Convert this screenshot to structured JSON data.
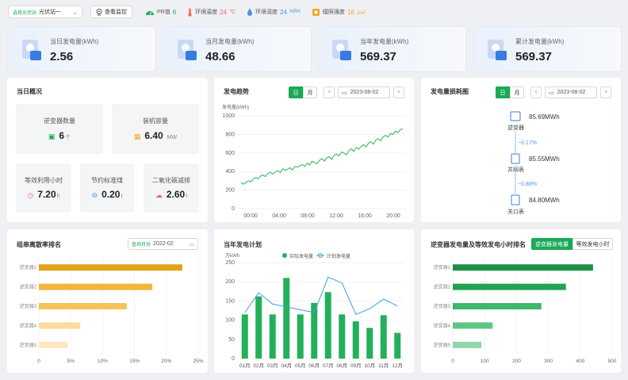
{
  "topbar": {
    "site_prefix": "选择光伏站",
    "site_value": "光伏站一",
    "monitor_label": "查看监控",
    "pr_label": "PR值",
    "pr_value": "6",
    "temp_label": "环境温度",
    "temp_value": "24",
    "temp_unit": "℃",
    "hum_label": "环境湿度",
    "hum_value": "24",
    "hum_unit": "%RH",
    "rad_label": "辐照强度",
    "rad_value": "16",
    "rad_unit": "J/㎡"
  },
  "stats": [
    {
      "label": "当日发电量(kWh)",
      "value": "2.56"
    },
    {
      "label": "当月发电量(kWh)",
      "value": "48.66"
    },
    {
      "label": "当年发电量(kWh)",
      "value": "569.37"
    },
    {
      "label": "累计发电量(kWh)",
      "value": "569.37"
    }
  ],
  "overview": {
    "title": "当日概况",
    "inverter_label": "逆变器数量",
    "inverter_value": "6",
    "inverter_unit": "个",
    "capacity_label": "装机容量",
    "capacity_value": "6.40",
    "capacity_unit": "MW",
    "hours_label": "等效利用小时",
    "hours_value": "7.20",
    "hours_unit": "h",
    "coal_label": "节约标准煤",
    "coal_value": "0.20",
    "coal_unit": "t",
    "co2_label": "二氧化碳减排",
    "co2_value": "2.60",
    "co2_unit": "t"
  },
  "trend": {
    "title": "发电趋势",
    "tab_day": "日",
    "tab_month": "月",
    "date": "2023-08-02",
    "prev": "<",
    "next": ">",
    "unit": "发电量(kWh)"
  },
  "loss": {
    "title": "发电量损耗图",
    "tab_day": "日",
    "tab_month": "月",
    "date": "2023-08-02",
    "prev": "<",
    "next": ">",
    "nodes": [
      {
        "name": "逆变器",
        "value": "85.69MWh"
      },
      {
        "name": "并网表",
        "value": "85.55MWh"
      },
      {
        "name": "关口表",
        "value": "84.80MWh"
      }
    ],
    "pct1": "−0.17%",
    "pct2": "−0.88%"
  },
  "dispersion": {
    "title": "组串离散率排名",
    "query_label": "查询月份",
    "query_value": "2022-02"
  },
  "plan": {
    "title": "当年发电计划",
    "unit": "万kWh",
    "legend_actual": "实际发电量",
    "legend_plan": "计划发电量"
  },
  "ranking": {
    "title": "逆变器发电量及等效发电小时排名",
    "tab1": "逆变器发电量",
    "tab2": "等效发电小时"
  },
  "chart_data": [
    {
      "type": "line",
      "title": "发电趋势",
      "ylabel": "发电量(kWh)",
      "ylim": [
        0,
        1000
      ],
      "yticks": [
        0,
        200,
        400,
        600,
        800,
        1000
      ],
      "xticks": [
        "00:00",
        "04:00",
        "08:00",
        "12:00",
        "16:00",
        "20:00"
      ],
      "series": [
        {
          "values": [
            280,
            262,
            285,
            300,
            291,
            320,
            335,
            322,
            352,
            362,
            345,
            380,
            392,
            372,
            395,
            410,
            388,
            430,
            412,
            425,
            440,
            418,
            455,
            448,
            462,
            475,
            455,
            490,
            470,
            510,
            495,
            485,
            520,
            540,
            512,
            548,
            560,
            530,
            575,
            590,
            570,
            610,
            600,
            580,
            625,
            645,
            615,
            660,
            640,
            670,
            690,
            665,
            705,
            720,
            695,
            740,
            752,
            730,
            775,
            790,
            770,
            810,
            800,
            835,
            820,
            850,
            860
          ]
        }
      ]
    },
    {
      "type": "bar",
      "title": "组串离散率排名",
      "orientation": "horizontal",
      "categories": [
        "逆变器1",
        "逆变器2",
        "逆变器3",
        "逆变器4",
        "逆变器5"
      ],
      "values": [
        22.5,
        17.8,
        13.8,
        6.5,
        4.5
      ],
      "xlim": [
        0,
        25
      ],
      "xticks": [
        "0",
        "5%",
        "10%",
        "15%",
        "20%",
        "25%"
      ]
    },
    {
      "type": "bar",
      "title": "当年发电计划",
      "ylabel": "万kWh",
      "ylim": [
        0,
        250
      ],
      "yticks": [
        0,
        50,
        100,
        150,
        200,
        250
      ],
      "categories": [
        "01月",
        "02月",
        "03月",
        "04月",
        "05月",
        "06月",
        "07月",
        "08月",
        "09月",
        "10月",
        "11月",
        "12月"
      ],
      "series": [
        {
          "name": "实际发电量",
          "type": "bar",
          "values": [
            115,
            162,
            115,
            210,
            115,
            145,
            173,
            115,
            97,
            80,
            113,
            67
          ]
        },
        {
          "name": "计划发电量",
          "type": "line",
          "values": [
            120,
            172,
            142,
            135,
            127,
            120,
            212,
            197,
            115,
            130,
            155,
            137
          ]
        }
      ]
    },
    {
      "type": "bar",
      "title": "逆变器发电量及等效发电小时排名",
      "orientation": "horizontal",
      "categories": [
        "逆变器1",
        "逆变器2",
        "逆变器3",
        "逆变器4",
        "逆变器5"
      ],
      "values": [
        440,
        355,
        278,
        125,
        90
      ],
      "xlim": [
        0,
        500
      ],
      "xticks": [
        "0",
        "100",
        "200",
        "300",
        "400",
        "500"
      ]
    }
  ]
}
